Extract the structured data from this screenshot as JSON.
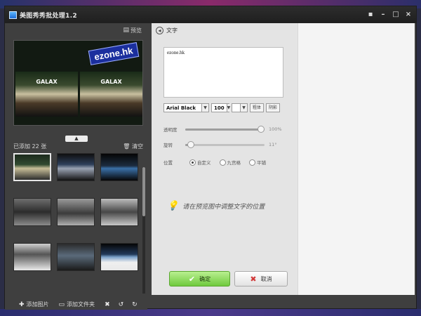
{
  "window": {
    "title": "美图秀秀批处理1.2",
    "controls": [
      "restore-icon",
      "minimize-icon",
      "maximize-icon",
      "close-icon"
    ]
  },
  "left_panel": {
    "preview_label": "预览",
    "watermark_text": "ezone.hk",
    "image_brand_text": "GALAX",
    "added_count_label": "已添加 22 张",
    "clear_label": "清空",
    "footer": {
      "add_image_label": "添加图片",
      "add_folder_label": "添加文件夹"
    }
  },
  "text_panel": {
    "header_label": "文字",
    "text_content": "ezone.hk",
    "font_name": "Arial Black",
    "font_size": "100",
    "color_value": "",
    "bold_label": "粗体",
    "shadow_label": "阴影",
    "opacity": {
      "label": "透明度",
      "value_text": "100%",
      "value": 1.0
    },
    "rotate": {
      "label": "旋转",
      "value_text": "11°",
      "value": 0.03
    },
    "position": {
      "label": "位置",
      "options": [
        "自定义",
        "九宫格",
        "平铺"
      ],
      "selected": "自定义"
    },
    "hint_text": "请在预览图中调整文字的位置",
    "ok_label": "确定",
    "cancel_label": "取消"
  }
}
